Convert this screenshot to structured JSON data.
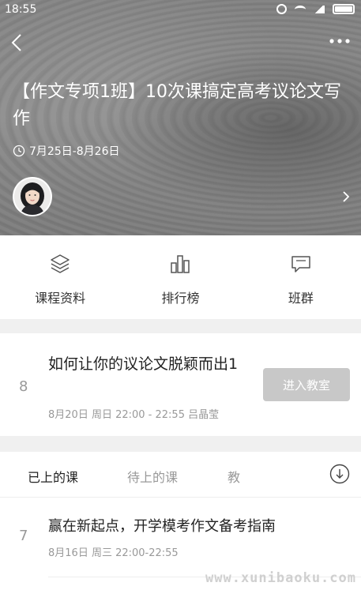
{
  "status_bar": {
    "time": "18:55"
  },
  "header": {
    "title": "【作文专项1班】10次课搞定高考议论文写作",
    "date_range": "7月25日-8月26日"
  },
  "actions": [
    {
      "label": "课程资料",
      "icon": "layers-icon"
    },
    {
      "label": "排行榜",
      "icon": "bar-chart-icon"
    },
    {
      "label": "班群",
      "icon": "chat-icon"
    }
  ],
  "current_lesson": {
    "number": "8",
    "title": "如何让你的议论文脱颖而出1",
    "meta": "8月20日 周日 22:00 - 22:55 吕晶莹",
    "button_label": "进入教室"
  },
  "tabs": [
    {
      "label": "已上的课",
      "active": true
    },
    {
      "label": "待上的课",
      "active": false
    },
    {
      "label": "教",
      "active": false
    }
  ],
  "past_lessons": [
    {
      "number": "7",
      "title": "赢在新起点，开学模考作文备考指南",
      "meta": "8月16日 周三 22:00-22:55"
    }
  ],
  "watermark": "www.xunibaoku.com"
}
